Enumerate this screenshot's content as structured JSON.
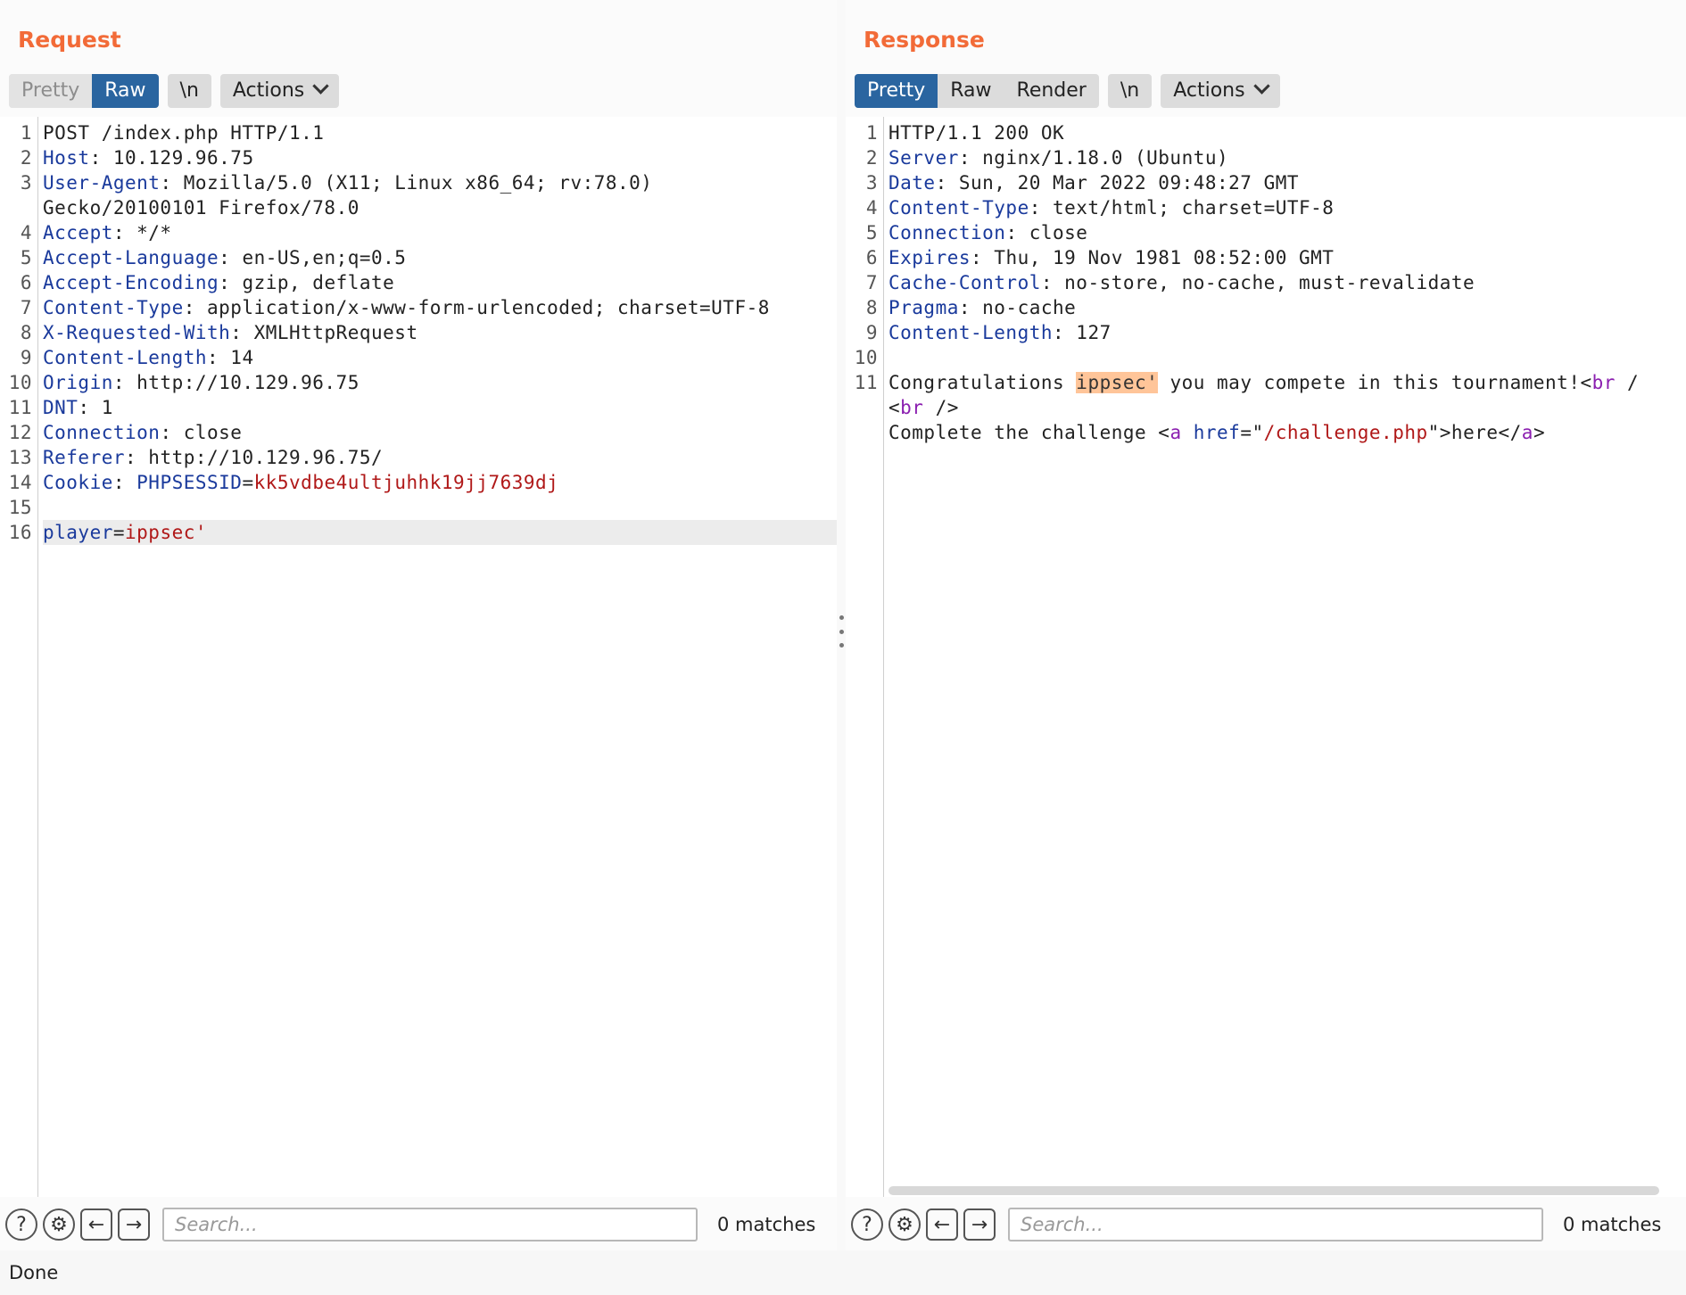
{
  "request": {
    "title": "Request",
    "tabs": [
      "Pretty",
      "Raw"
    ],
    "newline_label": "\\n",
    "actions_label": "Actions",
    "lines": [
      {
        "n": "1",
        "parts": [
          {
            "t": "POST /index.php HTTP/1.1",
            "c": ""
          }
        ]
      },
      {
        "n": "2",
        "parts": [
          {
            "t": "Host",
            "c": "k"
          },
          {
            "t": ": 10.129.96.75",
            "c": ""
          }
        ]
      },
      {
        "n": "3",
        "parts": [
          {
            "t": "User-Agent",
            "c": "k"
          },
          {
            "t": ": Mozilla/5.0 (X11; Linux x86_64; rv:78.0)",
            "c": ""
          }
        ]
      },
      {
        "n": "",
        "parts": [
          {
            "t": "Gecko/20100101 Firefox/78.0",
            "c": ""
          }
        ]
      },
      {
        "n": "4",
        "parts": [
          {
            "t": "Accept",
            "c": "k"
          },
          {
            "t": ": */*",
            "c": ""
          }
        ]
      },
      {
        "n": "5",
        "parts": [
          {
            "t": "Accept-Language",
            "c": "k"
          },
          {
            "t": ": en-US,en;q=0.5",
            "c": ""
          }
        ]
      },
      {
        "n": "6",
        "parts": [
          {
            "t": "Accept-Encoding",
            "c": "k"
          },
          {
            "t": ": gzip, deflate",
            "c": ""
          }
        ]
      },
      {
        "n": "7",
        "parts": [
          {
            "t": "Content-Type",
            "c": "k"
          },
          {
            "t": ": application/x-www-form-urlencoded; charset=UTF-8",
            "c": ""
          }
        ]
      },
      {
        "n": "8",
        "parts": [
          {
            "t": "X-Requested-With",
            "c": "k"
          },
          {
            "t": ": XMLHttpRequest",
            "c": ""
          }
        ]
      },
      {
        "n": "9",
        "parts": [
          {
            "t": "Content-Length",
            "c": "k"
          },
          {
            "t": ": 14",
            "c": ""
          }
        ]
      },
      {
        "n": "10",
        "parts": [
          {
            "t": "Origin",
            "c": "k"
          },
          {
            "t": ": http://10.129.96.75",
            "c": ""
          }
        ]
      },
      {
        "n": "11",
        "parts": [
          {
            "t": "DNT",
            "c": "k"
          },
          {
            "t": ": 1",
            "c": ""
          }
        ]
      },
      {
        "n": "12",
        "parts": [
          {
            "t": "Connection",
            "c": "k"
          },
          {
            "t": ": close",
            "c": ""
          }
        ]
      },
      {
        "n": "13",
        "parts": [
          {
            "t": "Referer",
            "c": "k"
          },
          {
            "t": ": http://10.129.96.75/",
            "c": ""
          }
        ]
      },
      {
        "n": "14",
        "parts": [
          {
            "t": "Cookie",
            "c": "k"
          },
          {
            "t": ": ",
            "c": ""
          },
          {
            "t": "PHPSESSID",
            "c": "k"
          },
          {
            "t": "=",
            "c": ""
          },
          {
            "t": "kk5vdbe4ultjuhhk19jj7639dj",
            "c": "v"
          }
        ]
      },
      {
        "n": "15",
        "parts": []
      },
      {
        "n": "16",
        "parts": [
          {
            "t": "player",
            "c": "k"
          },
          {
            "t": "=",
            "c": ""
          },
          {
            "t": "ippsec'",
            "c": "v"
          }
        ],
        "highlight": true
      }
    ],
    "search_placeholder": "Search...",
    "matches": "0 matches"
  },
  "response": {
    "title": "Response",
    "tabs": [
      "Pretty",
      "Raw",
      "Render"
    ],
    "newline_label": "\\n",
    "actions_label": "Actions",
    "lines": [
      {
        "n": "1",
        "parts": [
          {
            "t": "HTTP/1.1 200 OK",
            "c": ""
          }
        ]
      },
      {
        "n": "2",
        "parts": [
          {
            "t": "Server",
            "c": "k"
          },
          {
            "t": ": nginx/1.18.0 (Ubuntu)",
            "c": ""
          }
        ]
      },
      {
        "n": "3",
        "parts": [
          {
            "t": "Date",
            "c": "k"
          },
          {
            "t": ": Sun, 20 Mar 2022 09:48:27 GMT",
            "c": ""
          }
        ]
      },
      {
        "n": "4",
        "parts": [
          {
            "t": "Content-Type",
            "c": "k"
          },
          {
            "t": ": text/html; charset=UTF-8",
            "c": ""
          }
        ]
      },
      {
        "n": "5",
        "parts": [
          {
            "t": "Connection",
            "c": "k"
          },
          {
            "t": ": close",
            "c": ""
          }
        ]
      },
      {
        "n": "6",
        "parts": [
          {
            "t": "Expires",
            "c": "k"
          },
          {
            "t": ": Thu, 19 Nov 1981 08:52:00 GMT",
            "c": ""
          }
        ]
      },
      {
        "n": "7",
        "parts": [
          {
            "t": "Cache-Control",
            "c": "k"
          },
          {
            "t": ": no-store, no-cache, must-revalidate",
            "c": ""
          }
        ]
      },
      {
        "n": "8",
        "parts": [
          {
            "t": "Pragma",
            "c": "k"
          },
          {
            "t": ": no-cache",
            "c": ""
          }
        ]
      },
      {
        "n": "9",
        "parts": [
          {
            "t": "Content-Length",
            "c": "k"
          },
          {
            "t": ": 127",
            "c": ""
          }
        ]
      },
      {
        "n": "10",
        "parts": []
      },
      {
        "n": "11",
        "parts": [
          {
            "t": "Congratulations ",
            "c": ""
          },
          {
            "t": "ippsec'",
            "c": "mark"
          },
          {
            "t": " you may compete in this tournament!<",
            "c": ""
          },
          {
            "t": "br",
            "c": "t"
          },
          {
            "t": " /",
            "c": ""
          }
        ]
      },
      {
        "n": "",
        "parts": [
          {
            "t": "<",
            "c": ""
          },
          {
            "t": "br",
            "c": "t"
          },
          {
            "t": " />",
            "c": ""
          }
        ]
      },
      {
        "n": "",
        "parts": [
          {
            "t": "Complete the challenge <",
            "c": ""
          },
          {
            "t": "a",
            "c": "t"
          },
          {
            "t": " ",
            "c": ""
          },
          {
            "t": "href",
            "c": "k"
          },
          {
            "t": "=\"",
            "c": ""
          },
          {
            "t": "/challenge.php",
            "c": "v"
          },
          {
            "t": "\">here</",
            "c": ""
          },
          {
            "t": "a",
            "c": "t"
          },
          {
            "t": ">",
            "c": ""
          }
        ]
      }
    ],
    "search_placeholder": "Search...",
    "matches": "0 matches"
  },
  "status": "Done",
  "colors": {
    "accent": "#f26b38",
    "active_tab": "#2a65a0",
    "header_key": "#1a3a9c",
    "value": "#b01818",
    "tag": "#8b1fb0",
    "match_highlight": "#ffc599"
  }
}
